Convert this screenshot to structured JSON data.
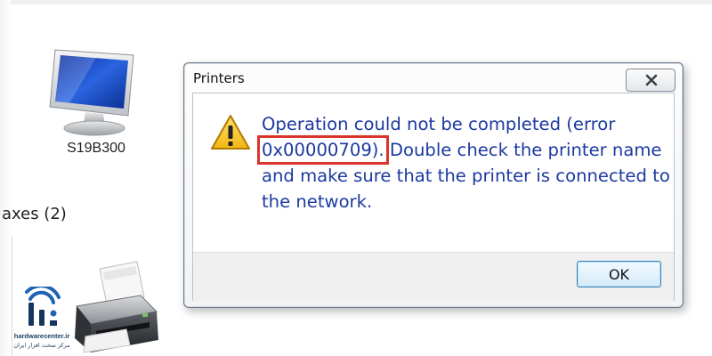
{
  "background": {
    "device_name": "S19B300",
    "group_header": "axes (2)",
    "logo": {
      "site": "hardwarecenter.ir",
      "subtitle_fa": "مرکز سخت افزار ایران"
    }
  },
  "dialog": {
    "title": "Printers",
    "message": {
      "part1": "Operation could not be completed (error ",
      "error_code": "0x00000709).",
      "part2": " Double check the printer name and make sure that the printer is connected to the network."
    },
    "ok_label": "OK",
    "icon": "warning-icon"
  },
  "colors": {
    "message_text": "#1c3aa0",
    "highlight_box": "#d9352a",
    "ok_border": "#3c7fb1"
  }
}
